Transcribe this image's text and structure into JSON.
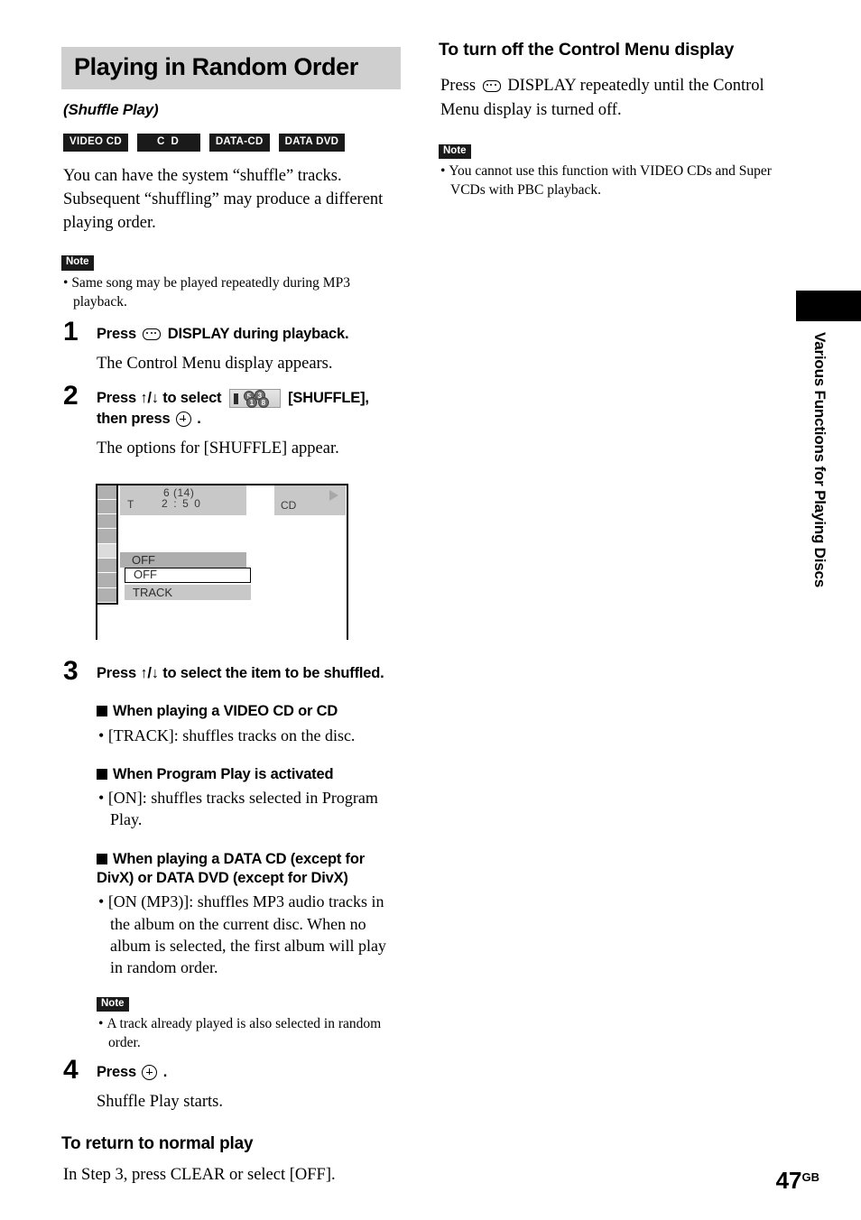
{
  "page": {
    "number": "47",
    "region_code": "GB"
  },
  "sidebar": {
    "tab_label": "",
    "vertical_title": "Various Functions for Playing Discs"
  },
  "left_column": {
    "section_title": "Playing in Random Order",
    "subtitle": "(Shuffle Play)",
    "disc_badges": [
      {
        "label": "VIDEO CD",
        "name": "badge-video-cd"
      },
      {
        "label": "C D",
        "name": "badge-cd"
      },
      {
        "label": "DATA-CD",
        "name": "badge-data-cd"
      },
      {
        "label": "DATA DVD",
        "name": "badge-data-dvd"
      }
    ],
    "intro": "You can have the system “shuffle” tracks. Subsequent “shuffling” may produce a different playing order.",
    "note_label": "Note",
    "note_items": [
      "Same song may be played repeatedly during MP3 playback."
    ],
    "steps": [
      {
        "number": "1",
        "head_before": "Press",
        "head_icon": "display-button-icon",
        "head_after": "DISPLAY during playback.",
        "body": "The Control Menu display appears."
      },
      {
        "number": "2",
        "head_before": "Press ↑/↓ to select",
        "head_icon": "shuffle-menu-icon",
        "head_mid": "[SHUFFLE],",
        "head_line2_before": "then press",
        "head_line2_icon": "enter-button-icon",
        "head_line2_after": ".",
        "body": "The options for [SHUFFLE] appear."
      },
      {
        "number": "3",
        "head": "Press ↑/↓ to select the item to be shuffled."
      },
      {
        "number": "4",
        "head_before": "Press",
        "head_icon": "enter-button-icon",
        "head_after": ".",
        "body": "Shuffle Play starts."
      }
    ],
    "step3_sections": [
      {
        "heading": "When playing a VIDEO CD or CD",
        "bullets": [
          "[TRACK]: shuffles tracks on the disc."
        ]
      },
      {
        "heading": "When Program Play is activated",
        "bullets": [
          "[ON]: shuffles tracks selected in Program Play."
        ]
      },
      {
        "heading": "When playing a DATA CD (except for DivX) or DATA DVD (except for DivX)",
        "bullets": [
          "[ON (MP3)]: shuffles MP3 audio tracks in the album on the current disc. When no album is selected, the first album will play in random order."
        ]
      }
    ],
    "step3_note_label": "Note",
    "step3_note_items": [
      "A track already played is also selected in random order."
    ],
    "return_heading": "To return to normal play",
    "return_body": "In Step 3, press CLEAR or select [OFF]."
  },
  "tv_diagram": {
    "track_current": "6 (14)",
    "track_prefix": "T",
    "time": "2 : 5 0",
    "disc_type": "CD",
    "play_indicator": "play-triangle-icon",
    "current_setting": "OFF",
    "options": [
      "OFF",
      "TRACK"
    ],
    "selected_option": "OFF",
    "icon_column_cells": 8,
    "icon_column_selected_index": 4,
    "shuffle_icon_numbers": [
      "5",
      "3",
      "1",
      "8"
    ]
  },
  "right_column": {
    "heading": "To turn off the Control Menu display",
    "body_before": "Press",
    "body_icon": "display-button-icon",
    "body_after": "DISPLAY repeatedly until the Control Menu display is turned off.",
    "note_label": "Note",
    "note_items": [
      "You cannot use this function with VIDEO CDs and Super VCDs with PBC playback."
    ]
  },
  "colors": {
    "title_band": "#cfcfcf",
    "badge_bg": "#1a1a1a",
    "screen_gray": "#c8c8c8",
    "screen_gray_dark": "#aeaeae",
    "icon_cell": "#b0b0b0",
    "icon_cell_selected": "#dcdcdc"
  }
}
